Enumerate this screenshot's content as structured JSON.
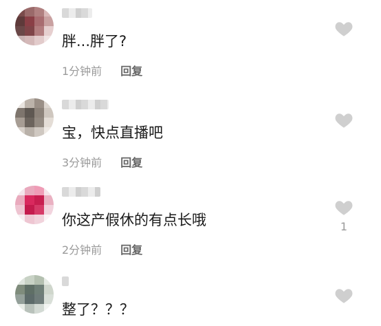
{
  "comments": [
    {
      "text": "胖...胖了?",
      "time": "1分钟前",
      "reply_label": "回复",
      "likes": "",
      "avatar_colors": [
        "#7a4b4b",
        "#9a6a6a",
        "#b08080",
        "#d9b8b8",
        "#5e3a3a",
        "#8a3f46",
        "#a86c70",
        "#c9a1a1",
        "#6a4848",
        "#7f4448",
        "#b27c7e",
        "#e6cfcf",
        "#c8b2b2",
        "#d4b8b8",
        "#e2cbcb",
        "#f1e4e4"
      ],
      "username_width": 44
    },
    {
      "text": "宝，快点直播吧",
      "time": "3分钟前",
      "reply_label": "回复",
      "likes": "",
      "avatar_colors": [
        "#e9e4df",
        "#bcb3aa",
        "#9a8f86",
        "#ddd6cf",
        "#7e756d",
        "#5f5852",
        "#8c8279",
        "#cfc7bf",
        "#a79d94",
        "#6c645d",
        "#938a81",
        "#e4ddd6",
        "#d6cfc8",
        "#b9b1a9",
        "#cfc8c1",
        "#efeae5"
      ],
      "username_width": 68
    },
    {
      "text": "你这产假休的有点长哦",
      "time": "2分钟前",
      "reply_label": "回复",
      "likes": "1",
      "avatar_colors": [
        "#f4e6ec",
        "#e9a9bd",
        "#ef9cb6",
        "#f6e3ea",
        "#e9aabd",
        "#d9295e",
        "#c81e50",
        "#eab1c2",
        "#eec4d1",
        "#c41b4d",
        "#d63a68",
        "#f2d4de",
        "#f7eef1",
        "#eec6d2",
        "#f1d3dc",
        "#fbf4f6"
      ],
      "username_width": 56
    },
    {
      "text": "整了？？？",
      "time": "",
      "reply_label": "",
      "likes": "",
      "avatar_colors": [
        "#dfe5de",
        "#c8d2c5",
        "#b4c0b0",
        "#e6ebe4",
        "#7f8c7c",
        "#5f6f66",
        "#6f7f77",
        "#cfd6cc",
        "#94a09a",
        "#5d6b6a",
        "#6f7c7a",
        "#d9dfd8",
        "#e7ece6",
        "#b9c2bb",
        "#d3dad4",
        "#f2f4f1"
      ],
      "username_width": 10
    }
  ],
  "icon": {
    "heart_color": "#cfcfcf"
  }
}
